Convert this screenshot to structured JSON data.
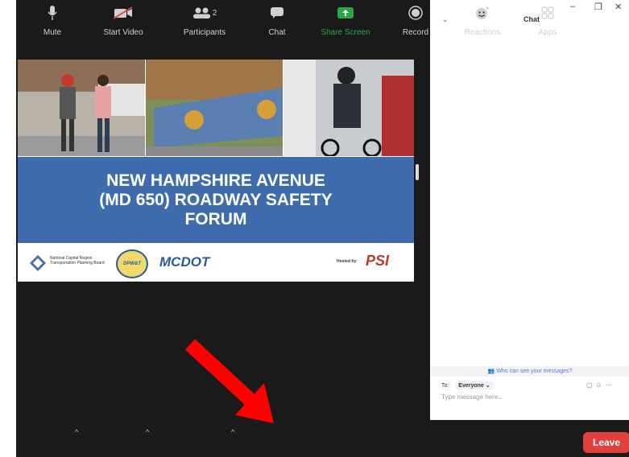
{
  "window": {
    "title": "Chat",
    "minimize": "–",
    "restore": "❐",
    "close": "✕"
  },
  "slide": {
    "title": "NEW HAMPSHIRE AVENUE\n(MD 650) ROADWAY SAFETY\nFORUM",
    "logo1_text": "National Capital Region\nTransportation Planning Board",
    "logo2_text": "DPW&T",
    "logo3_text": "MCDOT",
    "hosted_label": "Hosted by:",
    "host_logo": "PSI"
  },
  "chat": {
    "privacy_note": "Who can see your messages?",
    "to_label": "To:",
    "recipient": "Everyone",
    "placeholder": "Type message here..."
  },
  "toolbar": {
    "mute": "Mute",
    "start_video": "Start Video",
    "participants": "Participants",
    "participants_count": "2",
    "chat": "Chat",
    "share_screen": "Share Screen",
    "record": "Record",
    "reactions": "Reactions",
    "apps": "Apps",
    "leave": "Leave"
  },
  "colors": {
    "accent_green": "#28a745",
    "leave_red": "#e0413f",
    "banner_blue": "#3e6cac",
    "arrow_red": "#ff0000"
  }
}
